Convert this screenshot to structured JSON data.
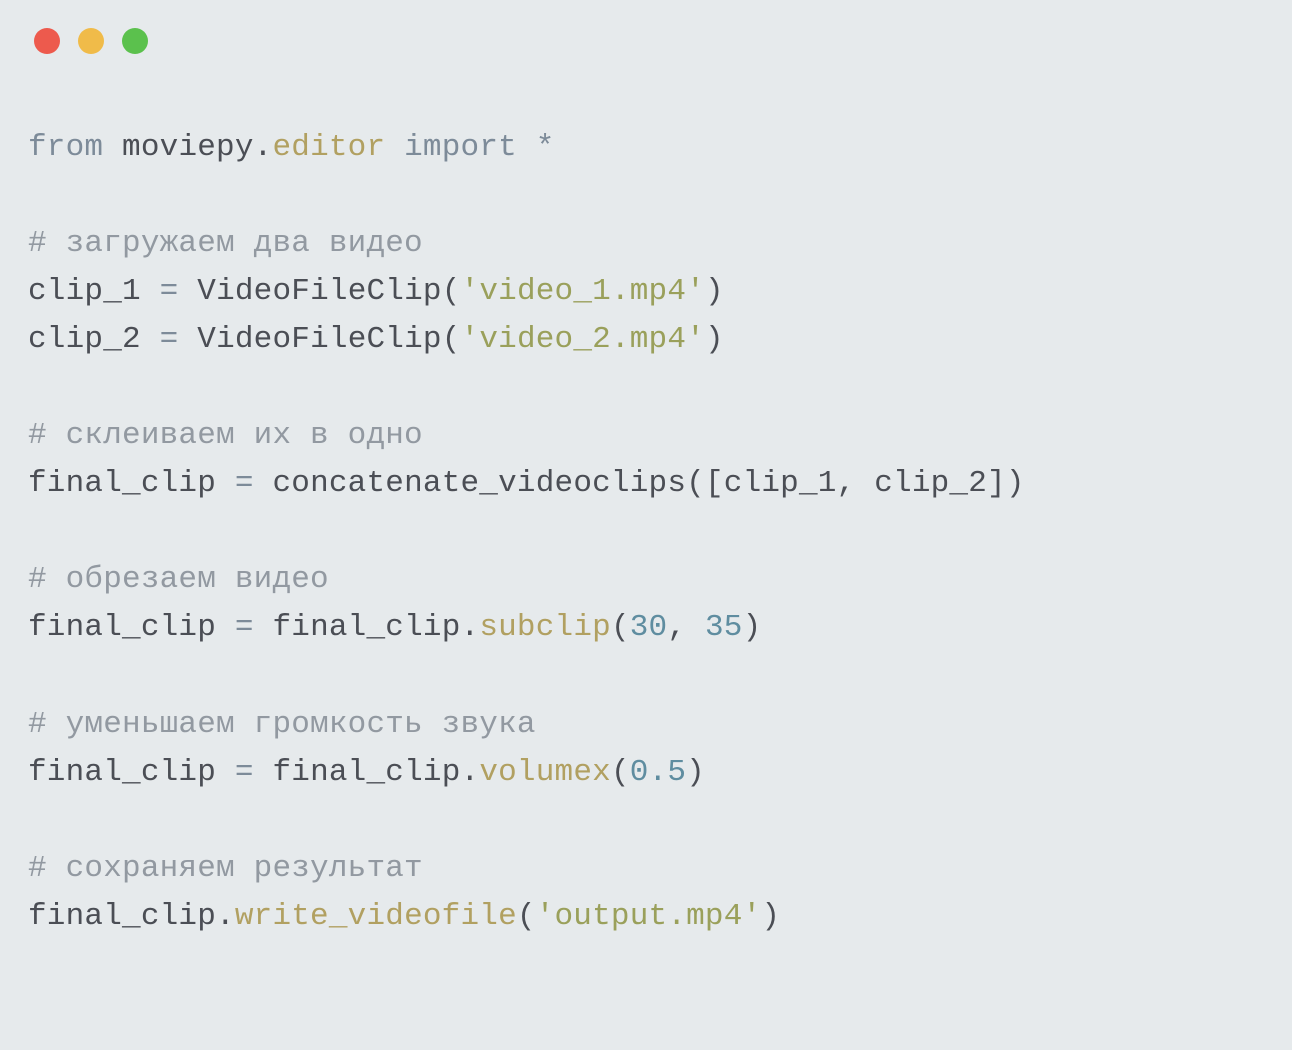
{
  "titlebar": {
    "buttons": [
      "close",
      "minimize",
      "zoom"
    ]
  },
  "code": {
    "kw_from": "from",
    "mod": "moviepy",
    "dot1": ".",
    "editor": "editor",
    "kw_import": "import",
    "star": "*",
    "cmt1": "# загружаем два видео",
    "clip1_lhs": "clip_1",
    "eq": "=",
    "vfc": "VideoFileClip",
    "lp": "(",
    "rp": ")",
    "str_v1": "'video_1.mp4'",
    "clip2_lhs": "clip_2",
    "str_v2": "'video_2.mp4'",
    "cmt2": "# склеиваем их в одно",
    "final_lhs": "final_clip",
    "concat": "concatenate_videoclips",
    "lb": "[",
    "rb": "]",
    "comma": ",",
    "clip1_ref": "clip_1",
    "clip2_ref": "clip_2",
    "cmt3": "# обрезаем видео",
    "final_rhs": "final_clip",
    "dot2": ".",
    "subclip": "subclip",
    "num30": "30",
    "num35": "35",
    "cmt4": "# уменьшаем громкость звука",
    "volumex": "volumex",
    "num05": "0.5",
    "cmt5": "# сохраняем результат",
    "write": "write_videofile",
    "str_out": "'output.mp4'"
  }
}
